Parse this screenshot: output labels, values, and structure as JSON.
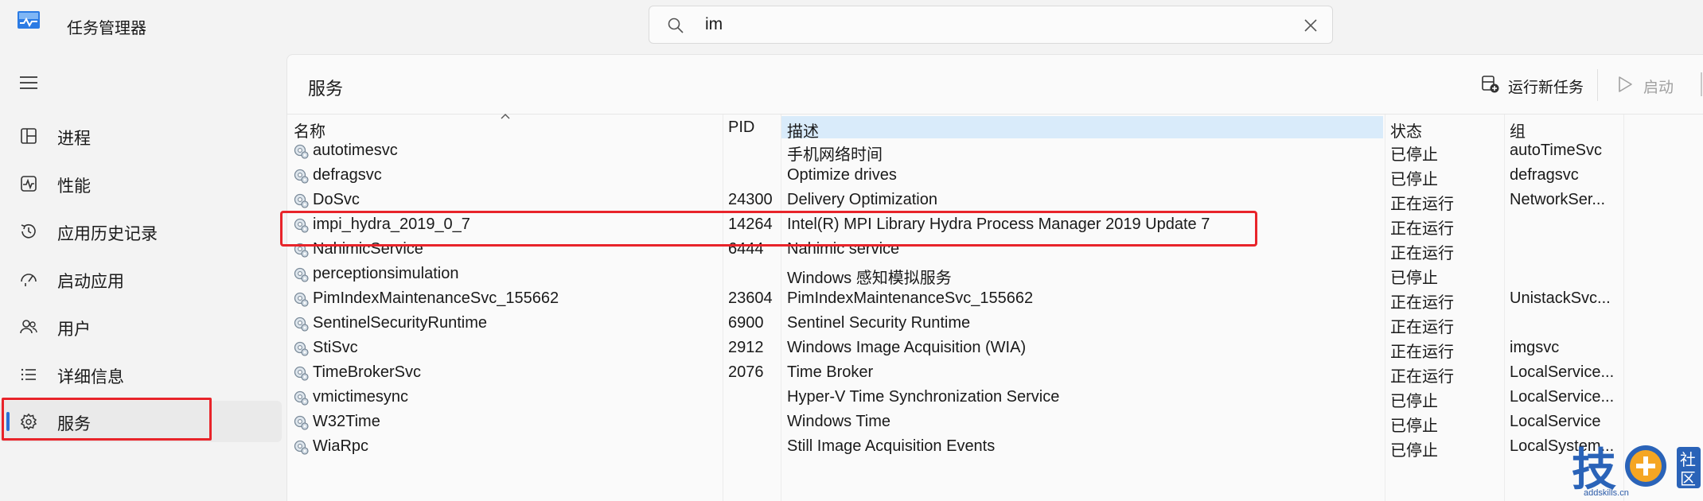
{
  "window": {
    "title": "任务管理器"
  },
  "search": {
    "value": "im",
    "placeholder": ""
  },
  "sidebar": {
    "items": [
      {
        "label": "进程",
        "icon": "processes-icon"
      },
      {
        "label": "性能",
        "icon": "performance-icon"
      },
      {
        "label": "应用历史记录",
        "icon": "app-history-icon"
      },
      {
        "label": "启动应用",
        "icon": "startup-apps-icon"
      },
      {
        "label": "用户",
        "icon": "users-icon"
      },
      {
        "label": "详细信息",
        "icon": "details-icon"
      },
      {
        "label": "服务",
        "icon": "services-icon",
        "active": true
      }
    ]
  },
  "main": {
    "title": "服务",
    "toolbar": {
      "run_task": "运行新任务",
      "start": "启动"
    },
    "columns": {
      "name": "名称",
      "pid": "PID",
      "desc": "描述",
      "status": "状态",
      "group": "组"
    },
    "rows": [
      {
        "name": "autotimesvc",
        "pid": "",
        "desc": "手机网络时间",
        "status": "已停止",
        "group": "autoTimeSvc"
      },
      {
        "name": "defragsvc",
        "pid": "",
        "desc": "Optimize drives",
        "status": "已停止",
        "group": "defragsvc"
      },
      {
        "name": "DoSvc",
        "pid": "24300",
        "desc": "Delivery Optimization",
        "status": "正在运行",
        "group": "NetworkSer..."
      },
      {
        "name": "impi_hydra_2019_0_7",
        "pid": "14264",
        "desc": "Intel(R) MPI Library Hydra Process Manager 2019 Update 7",
        "status": "正在运行",
        "group": ""
      },
      {
        "name": "NahimicService",
        "pid": "6444",
        "desc": "Nahimic service",
        "status": "正在运行",
        "group": ""
      },
      {
        "name": "perceptionsimulation",
        "pid": "",
        "desc": "Windows 感知模拟服务",
        "status": "已停止",
        "group": ""
      },
      {
        "name": "PimIndexMaintenanceSvc_155662",
        "pid": "23604",
        "desc": "PimIndexMaintenanceSvc_155662",
        "status": "正在运行",
        "group": "UnistackSvc..."
      },
      {
        "name": "SentinelSecurityRuntime",
        "pid": "6900",
        "desc": "Sentinel Security Runtime",
        "status": "正在运行",
        "group": ""
      },
      {
        "name": "StiSvc",
        "pid": "2912",
        "desc": "Windows Image Acquisition (WIA)",
        "status": "正在运行",
        "group": "imgsvc"
      },
      {
        "name": "TimeBrokerSvc",
        "pid": "2076",
        "desc": "Time Broker",
        "status": "正在运行",
        "group": "LocalService..."
      },
      {
        "name": "vmictimesync",
        "pid": "",
        "desc": "Hyper-V Time Synchronization Service",
        "status": "已停止",
        "group": "LocalService..."
      },
      {
        "name": "W32Time",
        "pid": "",
        "desc": "Windows Time",
        "status": "已停止",
        "group": "LocalService"
      },
      {
        "name": "WiaRpc",
        "pid": "",
        "desc": "Still Image Acquisition Events",
        "status": "已停止",
        "group": "LocalSystem..."
      }
    ]
  },
  "watermark": {
    "url": "addskills.cn"
  },
  "colors": {
    "accent": "#2b6fd6",
    "annotation": "#e8242a",
    "header_highlight": "#d9ebfa"
  }
}
